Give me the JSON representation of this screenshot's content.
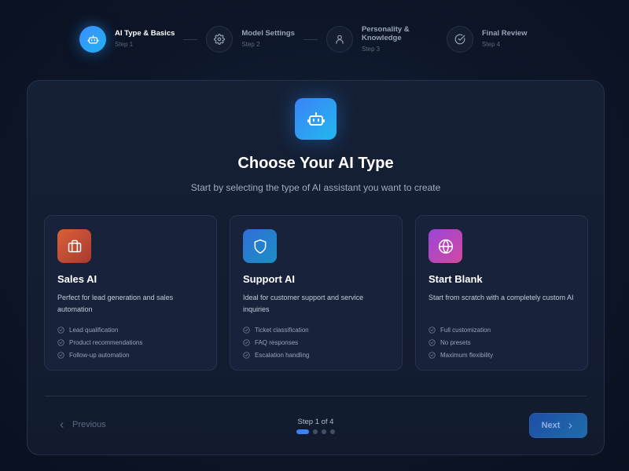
{
  "stepper": {
    "steps": [
      {
        "title": "AI Type & Basics",
        "subtitle": "Step 1",
        "icon": "bot-icon",
        "active": true
      },
      {
        "title": "Model Settings",
        "subtitle": "Step 2",
        "icon": "gear-icon",
        "active": false
      },
      {
        "title": "Personality & Knowledge",
        "subtitle": "Step 3",
        "icon": "user-icon",
        "active": false
      },
      {
        "title": "Final Review",
        "subtitle": "Step 4",
        "icon": "check-circle-icon",
        "active": false
      }
    ],
    "accent_color": "#3b82f6"
  },
  "main": {
    "hero_icon": "bot-icon",
    "title": "Choose Your AI Type",
    "subtitle": "Start by selecting the type of AI assistant you want to create",
    "cards": [
      {
        "title": "Sales AI",
        "description": "Perfect for lead generation and sales automation",
        "icon": "briefcase-icon",
        "icon_colors": [
          "#d9603a",
          "#a83a2f"
        ],
        "features": [
          "Lead qualification",
          "Product recommendations",
          "Follow-up automation"
        ]
      },
      {
        "title": "Support AI",
        "description": "Ideal for customer support and service inquiries",
        "icon": "shield-icon",
        "icon_colors": [
          "#2f6fd6",
          "#1d8fc4"
        ],
        "features": [
          "Ticket classification",
          "FAQ responses",
          "Escalation handling"
        ]
      },
      {
        "title": "Start Blank",
        "description": "Start from scratch with a completely custom AI",
        "icon": "globe-icon",
        "icon_colors": [
          "#9b45d8",
          "#d14a9f"
        ],
        "features": [
          "Full customization",
          "No presets",
          "Maximum flexibility"
        ]
      }
    ]
  },
  "footer": {
    "prev_label": "Previous",
    "next_label": "Next",
    "progress_label": "Step 1 of 4",
    "current_step": 1,
    "total_steps": 4
  }
}
